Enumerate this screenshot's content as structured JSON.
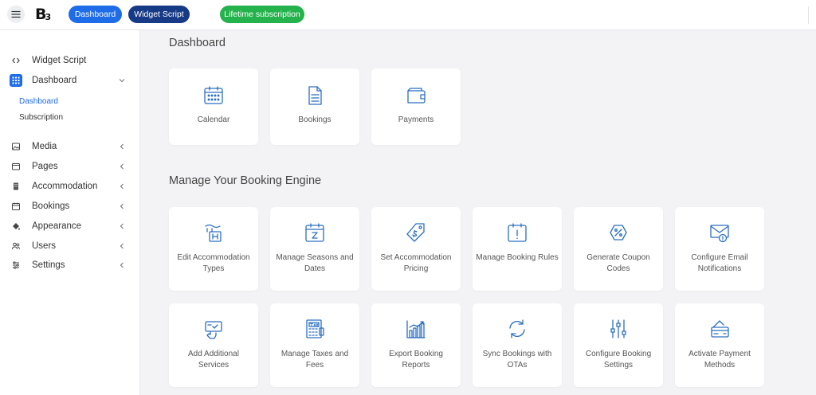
{
  "topbar": {
    "logo": "B",
    "logo_sub": "3",
    "pills": {
      "dashboard": "Dashboard",
      "widget_script": "Widget Script",
      "lifetime": "Lifetime subscription"
    }
  },
  "sidebar": {
    "items": [
      {
        "label": "Widget Script",
        "icon": "code-icon"
      },
      {
        "label": "Dashboard",
        "icon": "grid-icon",
        "expanded": true
      },
      {
        "label": "Media",
        "icon": "image-icon"
      },
      {
        "label": "Pages",
        "icon": "pages-icon"
      },
      {
        "label": "Accommodation",
        "icon": "building-icon"
      },
      {
        "label": "Bookings",
        "icon": "calendar-icon"
      },
      {
        "label": "Appearance",
        "icon": "paint-bucket-icon"
      },
      {
        "label": "Users",
        "icon": "users-icon"
      },
      {
        "label": "Settings",
        "icon": "sliders-icon"
      }
    ],
    "sub_items": {
      "dashboard": "Dashboard",
      "subscription": "Subscription"
    }
  },
  "main": {
    "dashboard_title": "Dashboard",
    "manage_title": "Manage Your Booking Engine",
    "dashboard_cards": [
      {
        "label": "Calendar",
        "icon": "calendar-icon"
      },
      {
        "label": "Bookings",
        "icon": "document-icon"
      },
      {
        "label": "Payments",
        "icon": "wallet-icon"
      }
    ],
    "manage_cards": [
      {
        "label": "Edit Accommodation Types",
        "icon": "hotel-sign-icon"
      },
      {
        "label": "Manage Seasons and Dates",
        "icon": "calendar-date-icon"
      },
      {
        "label": "Set Accommodation Pricing",
        "icon": "price-tag-icon"
      },
      {
        "label": "Manage Booking Rules",
        "icon": "calendar-alert-icon"
      },
      {
        "label": "Generate Coupon Codes",
        "icon": "coupon-icon"
      },
      {
        "label": "Configure Email Notifications",
        "icon": "email-alert-icon"
      },
      {
        "label": "Add Additional Services",
        "icon": "add-service-icon"
      },
      {
        "label": "Manage Taxes and Fees",
        "icon": "tax-icon"
      },
      {
        "label": "Export Booking Reports",
        "icon": "bar-chart-icon"
      },
      {
        "label": "Sync Bookings with OTAs",
        "icon": "sync-icon"
      },
      {
        "label": "Configure Booking Settings",
        "icon": "sliders-icon"
      },
      {
        "label": "Activate Payment Methods",
        "icon": "payment-card-icon"
      }
    ]
  },
  "colors": {
    "accent": "#1e6ce8",
    "navy": "#163a86",
    "green": "#23b24b",
    "icon_blue": "#2b6fc0"
  }
}
